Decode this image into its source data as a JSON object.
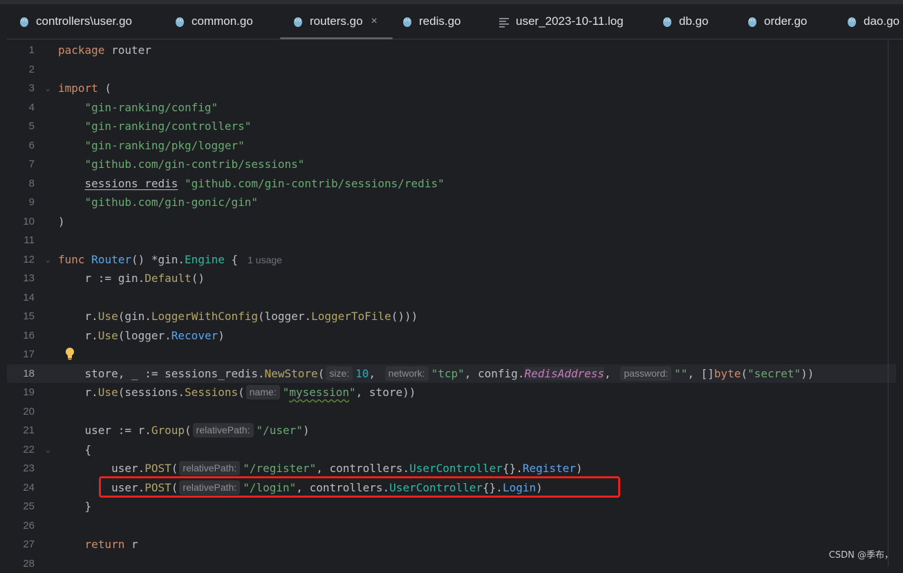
{
  "tabs": [
    {
      "label": "controllers\\user.go",
      "icon": "gopher-icon"
    },
    {
      "label": "common.go",
      "icon": "gopher-icon"
    },
    {
      "label": "routers.go",
      "icon": "gopher-icon",
      "active": true,
      "close": "×"
    },
    {
      "label": "redis.go",
      "icon": "gopher-icon"
    },
    {
      "label": "user_2023-10-11.log",
      "icon": "log-file-icon"
    },
    {
      "label": "db.go",
      "icon": "gopher-icon"
    },
    {
      "label": "order.go",
      "icon": "gopher-icon"
    },
    {
      "label": "dao.go",
      "icon": "gopher-icon"
    }
  ],
  "editor": {
    "line_numbers": [
      "1",
      "2",
      "3",
      "4",
      "5",
      "6",
      "7",
      "8",
      "9",
      "10",
      "11",
      "12",
      "13",
      "14",
      "15",
      "16",
      "17",
      "18",
      "19",
      "20",
      "21",
      "22",
      "23",
      "24",
      "25",
      "26",
      "27",
      "28"
    ],
    "current_line": "18",
    "usage_hint": "1 usage",
    "hints": {
      "size": "size:",
      "network": "network:",
      "password": "password:",
      "name": "name:",
      "relativePath": "relativePath:"
    },
    "code": {
      "l1": [
        "package",
        " router"
      ],
      "l3": [
        "import",
        " ("
      ],
      "l4": "\"gin-ranking/config\"",
      "l5": "\"gin-ranking/controllers\"",
      "l6": "\"gin-ranking/pkg/logger\"",
      "l7": "\"github.com/gin-contrib/sessions\"",
      "l8": [
        "sessions_redis",
        "\"github.com/gin-contrib/sessions/redis\""
      ],
      "l9": "\"github.com/gin-gonic/gin\"",
      "l10": ")",
      "l12": [
        "func",
        "Router",
        "() *",
        "gin",
        ".",
        "Engine",
        " {"
      ],
      "l13": [
        "r := ",
        "gin",
        ".",
        "Default",
        "()"
      ],
      "l15": [
        "r.",
        "Use",
        "(",
        "gin",
        ".",
        "LoggerWithConfig",
        "(",
        "logger",
        ".",
        "LoggerToFile",
        "()))"
      ],
      "l16": [
        "r.",
        "Use",
        "(",
        "logger",
        ".",
        "Recover",
        ")"
      ],
      "l18": [
        "store, _ := ",
        "sessions_redis",
        ".",
        "NewStore",
        "(",
        "10",
        ", ",
        "\"tcp\"",
        ", ",
        "config",
        ".",
        "RedisAddress",
        ", ",
        "\"\"",
        ", []",
        "byte",
        "(",
        "\"secret\"",
        "))"
      ],
      "l19": [
        "r.",
        "Use",
        "(",
        "sessions",
        ".",
        "Sessions",
        "(",
        "\"",
        "mysession",
        "\"",
        ", store))"
      ],
      "l21": [
        "user := r.",
        "Group",
        "(",
        "\"/user\"",
        ")"
      ],
      "l22": "{",
      "l23": [
        "user.",
        "POST",
        "(",
        "\"/register\"",
        ", ",
        "controllers",
        ".",
        "UserController",
        "{}.",
        "Register",
        ")"
      ],
      "l24": [
        "user.",
        "POST",
        "(",
        "\"/login\"",
        ", ",
        "controllers",
        ".",
        "UserController",
        "{}.",
        "Login",
        ")"
      ],
      "l25": "}",
      "l27": [
        "return",
        " r"
      ]
    }
  },
  "watermark": "CSDN @季布，",
  "colors": {
    "background": "#1e1f22",
    "keyword": "#cf8e6d",
    "string": "#6aab73",
    "function": "#56a8f5",
    "highlight_box": "#e8231e"
  }
}
